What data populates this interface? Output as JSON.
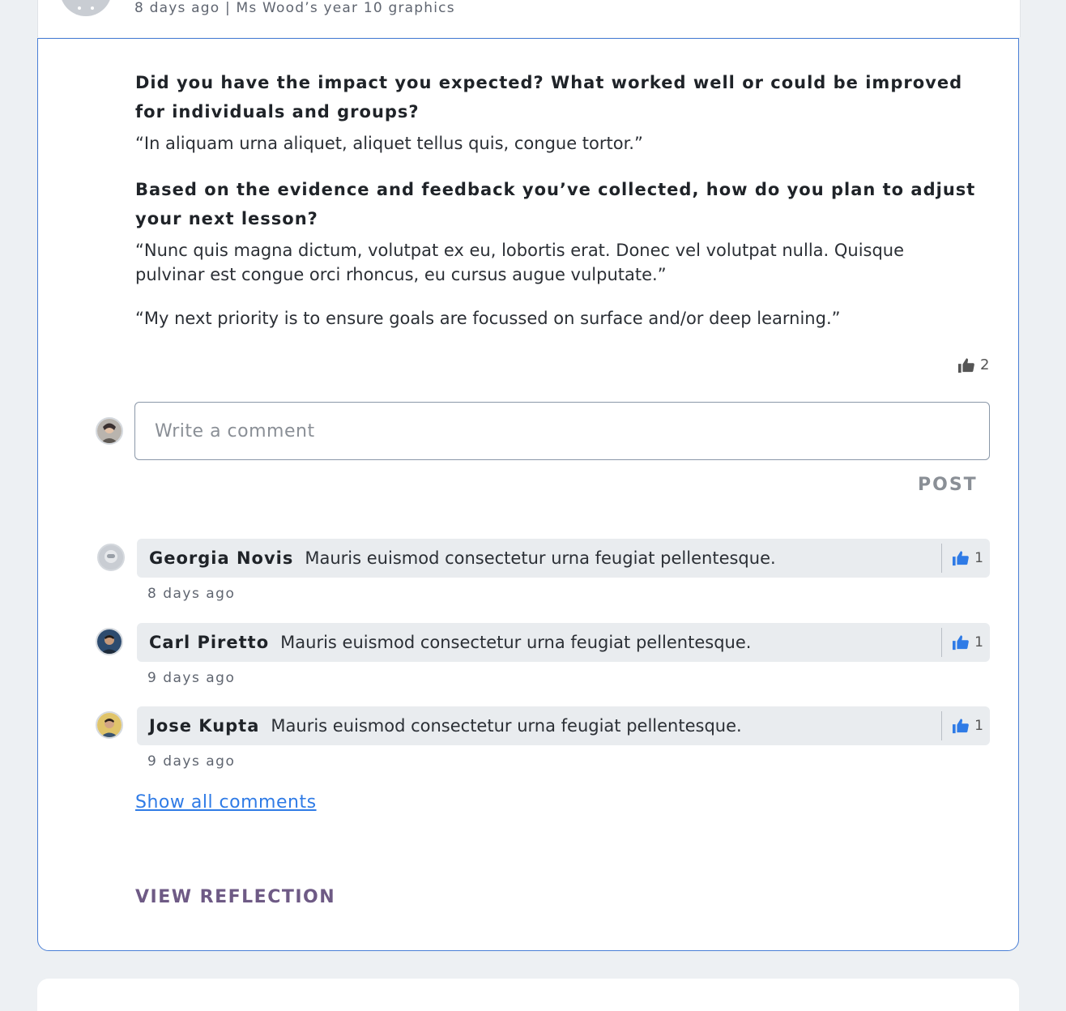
{
  "post": {
    "meta": "8 days ago | Ms Wood’s year 10 graphics",
    "questions": [
      {
        "question": "Did you have the impact you expected? What worked well or could be improved for individuals and groups?",
        "answers": [
          "“In aliquam urna aliquet, aliquet tellus quis, congue tortor.”"
        ]
      },
      {
        "question": "Based on the evidence and feedback you’ve collected, how do you plan to adjust your next lesson?",
        "answers": [
          "“Nunc quis magna dictum, volutpat ex eu, lobortis erat. Donec vel volutpat nulla. Quisque pulvinar est congue orci rhoncus, eu cursus augue vulputate.”",
          "“My next priority is to ensure goals are focussed on surface and/or deep learning.”"
        ]
      }
    ],
    "likes": "2",
    "like_icon": "thumbs-up-icon"
  },
  "comment_box": {
    "placeholder": "Write a comment",
    "post_label": "POST"
  },
  "comments": [
    {
      "name": "Georgia Novis",
      "text": "Mauris euismod consectetur urna feugiat pellentesque.",
      "time": "8 days ago",
      "likes": "1"
    },
    {
      "name": "Carl Piretto",
      "text": "Mauris euismod consectetur urna feugiat pellentesque.",
      "time": "9 days ago",
      "likes": "1"
    },
    {
      "name": "Jose Kupta",
      "text": "Mauris euismod consectetur urna feugiat pellentesque.",
      "time": "9 days ago",
      "likes": "1"
    }
  ],
  "links": {
    "show_all": "Show all comments",
    "view_reflection": "VIEW REFLECTION"
  },
  "colors": {
    "accent": "#4a7fd6",
    "like_blue": "#2f7be6",
    "reflection_purple": "#6e5a85"
  }
}
